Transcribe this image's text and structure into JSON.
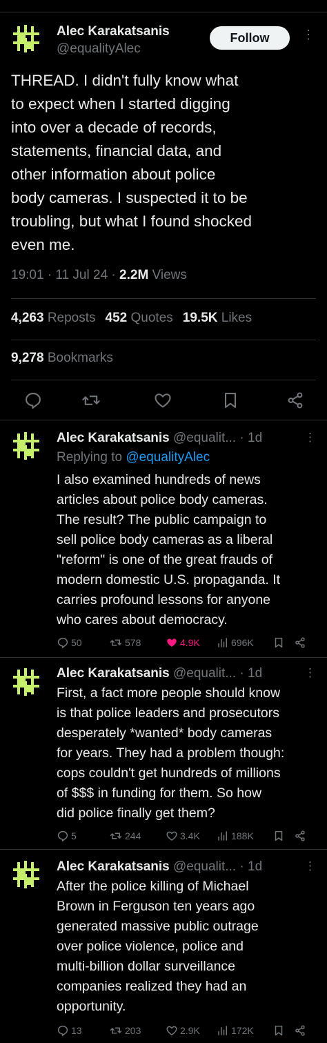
{
  "main_tweet": {
    "author_name": "Alec Karakatsanis",
    "author_handle": "@equalityAlec",
    "follow_label": "Follow",
    "text": "THREAD. I didn't fully know what\nto expect when I started digging\ninto over a decade of records,\nstatements, financial data, and\nother information about police\nbody cameras. I suspected it to be\ntroubling, but what I found shocked\neven me.",
    "time": "19:01 · 11 Jul 24 · ",
    "views_count": "2.2M",
    "views_label": " Views",
    "reposts_count": "4,263",
    "reposts_label": " Reposts",
    "quotes_count": "452",
    "quotes_label": " Quotes",
    "likes_count": "19.5K",
    "likes_label": " Likes",
    "bookmarks_count": "9,278",
    "bookmarks_label": " Bookmarks"
  },
  "replies": [
    {
      "name": "Alec Karakatsanis",
      "handle": " @equalit...",
      "age": " · 1d",
      "replying_prefix": "Replying to ",
      "replying_to": "@equalityAlec",
      "text": "I also examined hundreds of news\narticles about police body cameras.\nThe result? The public campaign to\nsell police body cameras as a liberal\n\"reform\" is one of the great frauds of\nmodern domestic U.S. propaganda.  It\ncarries profound lessons for anyone\nwho cares about democracy.",
      "replies": "50",
      "reposts": "578",
      "likes": "4.9K",
      "views": "696K",
      "liked": true
    },
    {
      "name": "Alec Karakatsanis",
      "handle": " @equalit...",
      "age": " · 1d",
      "text": "First, a fact more people should know\nis that police leaders and prosecutors\ndesperately *wanted* body cameras\nfor years. They had a problem though:\ncops couldn't get hundreds of millions\nof $$$ in funding for them. So how\ndid police finally get them?",
      "replies": "5",
      "reposts": "244",
      "likes": "3.4K",
      "views": "188K",
      "liked": false
    },
    {
      "name": "Alec Karakatsanis",
      "handle": " @equalit...",
      "age": " · 1d",
      "text": "After the police killing of Michael\nBrown in Ferguson ten years ago\ngenerated massive public outrage\nover police violence, police and\nmulti-billion dollar surveillance\ncompanies realized they had an\nopportunity.",
      "replies": "13",
      "reposts": "203",
      "likes": "2.9K",
      "views": "172K",
      "liked": false
    }
  ],
  "icons": {
    "reply": "reply-icon",
    "repost": "repost-icon",
    "like": "heart-icon",
    "bookmark": "bookmark-icon",
    "share": "share-icon",
    "views": "views-icon",
    "more": "more-icon"
  },
  "colors": {
    "background": "#000000",
    "text": "#e7e9ea",
    "muted": "#71767b",
    "link": "#1d9bf0",
    "like": "#f91880",
    "avatar_accent": "#c6f06a"
  }
}
